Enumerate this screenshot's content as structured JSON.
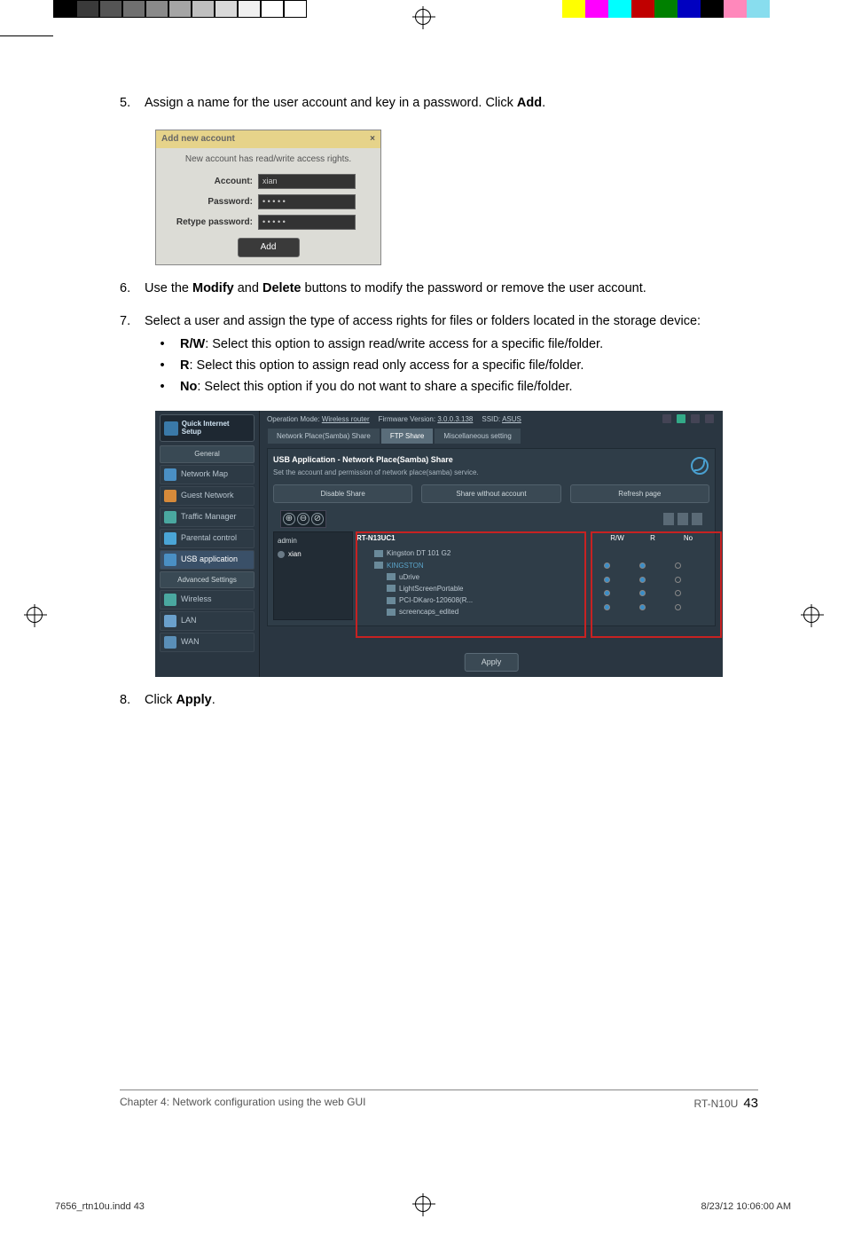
{
  "steps": {
    "5": {
      "num": "5.",
      "text_before": "Assign a name for the user account and key in a password. Click ",
      "bold": "Add",
      "text_after": "."
    },
    "6": {
      "num": "6.",
      "text_before": "Use the ",
      "bold1": "Modify",
      "text_mid": " and ",
      "bold2": "Delete",
      "text_after": " buttons to modify the password or remove the user account."
    },
    "7": {
      "num": "7.",
      "text": "Select a user and assign the type of access rights for files or folders located in the storage device:",
      "bullets": [
        {
          "label": "R/W",
          "text": ": Select this option to assign read/write access for a specific file/folder."
        },
        {
          "label": "R",
          "text": ": Select this option to assign read only access for a specific file/folder."
        },
        {
          "label": "No",
          "text": ": Select this option if you do not want to share a specific file/folder."
        }
      ]
    },
    "8": {
      "num": "8.",
      "text_before": "Click ",
      "bold": "Apply",
      "text_after": "."
    }
  },
  "dialog": {
    "title": "Add new account",
    "close": "×",
    "msg": "New account has read/write access rights.",
    "account_label": "Account:",
    "account_value": "xian",
    "password_label": "Password:",
    "password_value": "• • • • •",
    "retype_label": "Retype password:",
    "retype_value": "• • • • •",
    "add_btn": "Add"
  },
  "router": {
    "qis": "Quick Internet Setup",
    "section_general": "General",
    "section_advanced": "Advanced Settings",
    "nav": {
      "network_map": "Network Map",
      "guest_network": "Guest Network",
      "traffic_manager": "Traffic Manager",
      "parental_control": "Parental control",
      "usb_application": "USB application",
      "wireless": "Wireless",
      "lan": "LAN",
      "wan": "WAN"
    },
    "top": {
      "opmode_label": "Operation Mode:",
      "opmode_value": "Wireless router",
      "fw_label": "Firmware Version:",
      "fw_value": "3.0.0.3.138",
      "ssid_label": "SSID:",
      "ssid_value": "ASUS"
    },
    "tabs": {
      "samba": "Network Place(Samba) Share",
      "ftp": "FTP Share",
      "misc": "Miscellaneous setting"
    },
    "panel": {
      "title": "USB Application - Network Place(Samba) Share",
      "sub": "Set the account and permission of network place(samba) service.",
      "btn_disable": "Disable Share",
      "btn_share_no_acct": "Share without account",
      "btn_refresh": "Refresh page"
    },
    "tb_plus": "⊕",
    "tb_minus": "⊖",
    "tb_edit": "⊘",
    "users": {
      "admin": "admin",
      "xian": "xian"
    },
    "files": {
      "device": "RT-N13UC1",
      "col_rw": "R/W",
      "col_r": "R",
      "col_no": "No",
      "kingston": "Kingston DT 101 G2",
      "kingston_root": "KINGSTON",
      "folders": [
        "uDrive",
        "LightScreenPortable",
        "PCI-DKaro-120608(R...",
        "screencaps_edited"
      ]
    },
    "apply": "Apply"
  },
  "footer": {
    "chapter": "Chapter 4: Network configuration using the web GUI",
    "model": "RT-N10U",
    "page": "43"
  },
  "slug": {
    "file": "7656_rtn10u.indd   43",
    "datetime": "8/23/12   10:06:00 AM"
  },
  "colorbar_left": [
    "#000000",
    "#3a3a3a",
    "#555555",
    "#707070",
    "#8a8a8a",
    "#a5a5a5",
    "#bfbfbf",
    "#d9d9d9",
    "#f0f0f0",
    "#ffffff",
    "#ffffff"
  ],
  "colorbar_right": [
    "#ffff00",
    "#ff00ff",
    "#00ffff",
    "#c00000",
    "#008000",
    "#0000c0",
    "#000000",
    "#ff88bb",
    "#88ddee",
    "#ffffff"
  ]
}
